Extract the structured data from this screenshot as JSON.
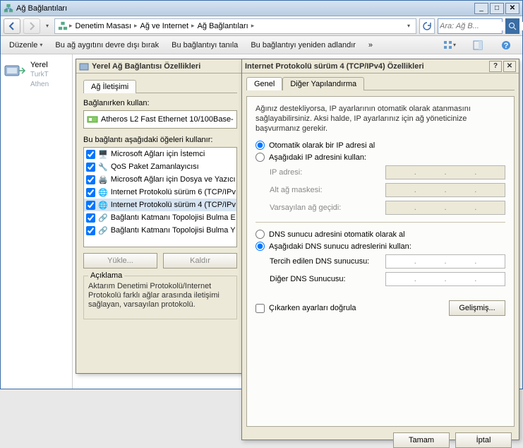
{
  "window": {
    "title": "Ağ Bağlantıları"
  },
  "nav": {
    "breadcrumb": [
      "Denetim Masası",
      "Ağ ve Internet",
      "Ağ Bağlantıları"
    ],
    "search_placeholder": "Ara: Ağ B..."
  },
  "cmdbar": {
    "organize": "Düzenle",
    "disable": "Bu ağ aygıtını devre dışı bırak",
    "diagnose": "Bu bağlantıyı tanıla",
    "rename": "Bu bağlantıyı yeniden adlandır",
    "more": "»"
  },
  "navpane": {
    "items": [
      {
        "name": "Yerel",
        "sub1": "TurkT",
        "sub2": "Athen"
      }
    ]
  },
  "dlg_props": {
    "title": "Yerel Ağ Bağlantısı Özellikleri",
    "tab_net": "Ağ İletişimi",
    "connect_using": "Bağlanırken kullan:",
    "adapter": "Atheros L2 Fast Ethernet 10/100Base-",
    "items_label": "Bu bağlantı aşağıdaki öğeleri kullanır:",
    "items": [
      "Microsoft Ağları için İstemci",
      "QoS Paket Zamanlayıcısı",
      "Microsoft Ağları için Dosya ve Yazıcı",
      "Internet Protokolü sürüm 6 (TCP/IPv",
      "Internet Protokolü sürüm 4 (TCP/IPv",
      "Bağlantı Katmanı Topolojisi Bulma E",
      "Bağlantı Katmanı Topolojisi Bulma Y"
    ],
    "btn_install": "Yükle...",
    "btn_uninstall": "Kaldır",
    "desc_h": "Açıklama",
    "desc_t": "Aktarım Denetimi Protokolü/Internet Protokolü farklı ağlar arasında iletişimi sağlayan, varsayılan protokolü."
  },
  "dlg_ip": {
    "title": "Internet Protokolü sürüm 4 (TCP/IPv4) Özellikleri",
    "tab_general": "Genel",
    "tab_alt": "Diğer Yapılandırma",
    "info": "Ağınız destekliyorsa, IP ayarlarının otomatik olarak atanmasını sağlayabilirsiniz. Aksi halde, IP ayarlarınız için ağ yöneticinize başvurmanız gerekir.",
    "r_auto_ip": "Otomatik olarak bir IP adresi al",
    "r_man_ip": "Aşağıdaki IP adresini kullan:",
    "f_ip": "IP adresi:",
    "f_mask": "Alt ağ maskesi:",
    "f_gw": "Varsayılan ağ geçidi:",
    "r_auto_dns": "DNS sunucu adresini otomatik olarak al",
    "r_man_dns": "Aşağıdaki DNS sunucu adreslerini kullan:",
    "f_dns1": "Tercih edilen DNS sunucusu:",
    "f_dns2": "Diğer DNS Sunucusu:",
    "chk_validate": "Çıkarken ayarları doğrula",
    "btn_adv": "Gelişmiş...",
    "btn_ok": "Tamam",
    "btn_cancel": "İptal"
  }
}
